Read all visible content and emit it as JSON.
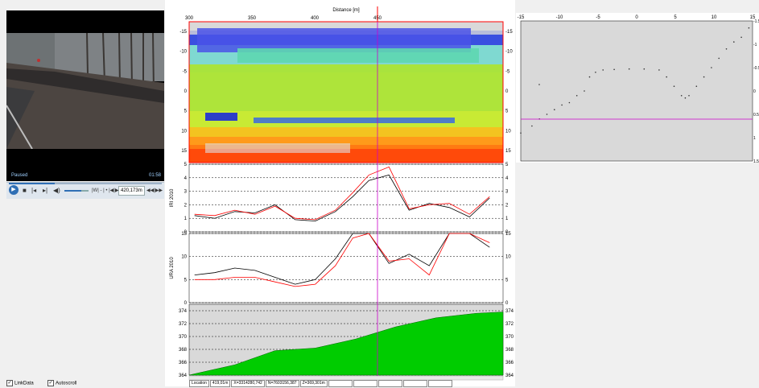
{
  "video": {
    "status": "Paused",
    "time": "01:58",
    "position": "420,173m"
  },
  "options": {
    "linkdata_label": "LinkData",
    "autoscroll_label": "Autoscroll",
    "linkdata_checked": true,
    "autoscroll_checked": true
  },
  "top_axis": {
    "title": "Distance [m]",
    "ticks": [
      "300",
      "350",
      "400",
      "450"
    ]
  },
  "heatmap": {
    "y_ticks": [
      "-15",
      "-10",
      "-5",
      "0",
      "5",
      "10",
      "15"
    ]
  },
  "chart_data": [
    {
      "type": "line",
      "ylabel": "IRI 2010",
      "ylim": [
        0,
        5
      ],
      "y_ticks": [
        "0",
        "1",
        "2",
        "3",
        "4",
        "5"
      ],
      "x": [
        300,
        315,
        330,
        345,
        360,
        375,
        390,
        405,
        418,
        430,
        445,
        460,
        475,
        490,
        505,
        520
      ],
      "series": [
        {
          "color": "#000000",
          "values": [
            1.2,
            1.0,
            1.5,
            1.4,
            2.0,
            0.9,
            0.8,
            1.5,
            2.6,
            3.8,
            4.2,
            1.6,
            2.1,
            1.8,
            1.1,
            2.5
          ]
        },
        {
          "color": "#ff0000",
          "values": [
            1.3,
            1.2,
            1.6,
            1.3,
            1.9,
            1.0,
            0.9,
            1.6,
            2.9,
            4.2,
            4.8,
            1.7,
            2.0,
            2.1,
            1.3,
            2.6
          ]
        }
      ]
    },
    {
      "type": "line",
      "ylabel": "URA 2010",
      "ylim": [
        0,
        15
      ],
      "y_ticks": [
        "0",
        "5",
        "10",
        "15"
      ],
      "x": [
        300,
        315,
        330,
        345,
        360,
        375,
        390,
        405,
        418,
        430,
        445,
        460,
        475,
        490,
        505,
        520
      ],
      "series": [
        {
          "color": "#000000",
          "values": [
            6.0,
            6.5,
            7.5,
            7.0,
            5.5,
            4.0,
            5.0,
            9.5,
            15.0,
            15.0,
            8.5,
            10.5,
            8.0,
            15.0,
            15.0,
            12.0
          ]
        },
        {
          "color": "#ff0000",
          "values": [
            5.0,
            5.0,
            5.5,
            5.5,
            4.5,
            3.5,
            4.0,
            8.0,
            14.0,
            15.0,
            9.0,
            9.5,
            6.0,
            15.0,
            15.0,
            13.0
          ]
        }
      ]
    },
    {
      "type": "area",
      "ylim": [
        364,
        375
      ],
      "y_ticks": [
        "364",
        "366",
        "368",
        "370",
        "372",
        "374"
      ],
      "x": [
        300,
        330,
        360,
        390,
        420,
        450,
        480,
        510,
        530
      ],
      "series": [
        {
          "color": "#00cc00",
          "values": [
            364.2,
            365.6,
            367.8,
            368.2,
            369.6,
            371.5,
            372.9,
            373.6,
            373.8
          ]
        }
      ]
    }
  ],
  "profile": {
    "x_ticks": [
      "-15",
      "-10",
      "-5",
      "0",
      "5",
      "10",
      "15"
    ],
    "y_ticks": [
      "-1.5",
      "-1",
      "-0.5",
      "0",
      "0.5",
      "1",
      "1.5"
    ]
  },
  "status": {
    "location": "Location",
    "location_value": "419,01m",
    "coord1": "X=3314280,742",
    "coord2": "N=7603156,387",
    "coord3": "Z=369,301m"
  },
  "colors": {
    "cursor": "#cc00cc",
    "red_marker": "#ff0000"
  }
}
